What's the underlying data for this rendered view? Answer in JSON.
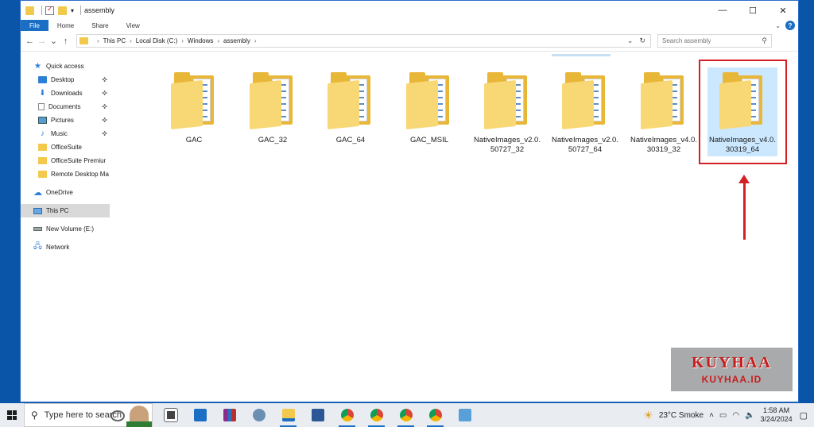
{
  "window": {
    "title": "assembly",
    "controls": {
      "minimize": "—",
      "maximize": "☐",
      "close": "✕"
    }
  },
  "ribbon": {
    "tabs": [
      "File",
      "Home",
      "Share",
      "View"
    ],
    "help": "?"
  },
  "nav": {
    "back": "←",
    "forward": "→",
    "recent": "⌄",
    "up": "↑",
    "breadcrumb": [
      "This PC",
      "Local Disk (C:)",
      "Windows",
      "assembly"
    ],
    "dropdown": "⌄",
    "refresh": "↻",
    "search_placeholder": "Search assembly"
  },
  "sidebar": {
    "quick_access": "Quick access",
    "pinned": [
      {
        "label": "Desktop",
        "icon": "desktop-icon",
        "pinned": true
      },
      {
        "label": "Downloads",
        "icon": "downloads-icon",
        "pinned": true
      },
      {
        "label": "Documents",
        "icon": "documents-icon",
        "pinned": true
      },
      {
        "label": "Pictures",
        "icon": "pictures-icon",
        "pinned": true
      },
      {
        "label": "Music",
        "icon": "music-icon",
        "pinned": true
      },
      {
        "label": "OfficeSuite",
        "icon": "folder-icon",
        "pinned": false
      },
      {
        "label": "OfficeSuite Premiur",
        "icon": "folder-icon",
        "pinned": false
      },
      {
        "label": "Remote Desktop Ma",
        "icon": "folder-icon",
        "pinned": false
      }
    ],
    "onedrive": "OneDrive",
    "this_pc": "This PC",
    "volume": "New Volume (E:)",
    "network": "Network"
  },
  "folders": [
    {
      "name": "GAC",
      "selected": false
    },
    {
      "name": "GAC_32",
      "selected": false
    },
    {
      "name": "GAC_64",
      "selected": false
    },
    {
      "name": "GAC_MSIL",
      "selected": false
    },
    {
      "name": "NativeImages_v2.0.50727_32",
      "selected": false
    },
    {
      "name": "NativeImages_v2.0.50727_64",
      "selected": false
    },
    {
      "name": "NativeImages_v4.0.30319_32",
      "selected": false
    },
    {
      "name": "NativeImages_v4.0.30319_64",
      "selected": true
    }
  ],
  "watermark": {
    "logo_text": "KUYHAA",
    "site_text": "KUYHAA.ID"
  },
  "taskbar": {
    "search_placeholder": "Type here to search",
    "weather": "23°C  Smoke",
    "time": "1:58 AM",
    "date": "3/24/2024"
  },
  "colors": {
    "accent": "#1a6ec4",
    "highlight_red": "#d41f26",
    "selection": "#cce8ff",
    "folder": "#f2c94c"
  }
}
